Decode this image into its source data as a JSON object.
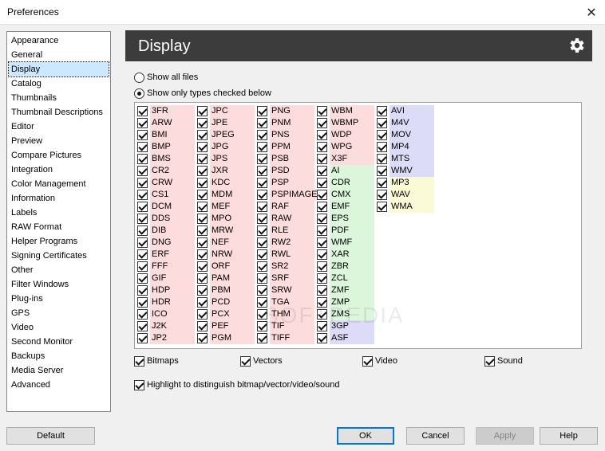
{
  "window": {
    "title": "Preferences",
    "close_glyph": "✕"
  },
  "sidebar": {
    "items": [
      {
        "label": "Appearance"
      },
      {
        "label": "General"
      },
      {
        "label": "Display",
        "selected": true
      },
      {
        "label": "Catalog"
      },
      {
        "label": "Thumbnails"
      },
      {
        "label": "Thumbnail Descriptions"
      },
      {
        "label": "Editor"
      },
      {
        "label": "Preview"
      },
      {
        "label": "Compare Pictures"
      },
      {
        "label": "Integration"
      },
      {
        "label": "Color Management"
      },
      {
        "label": "Information"
      },
      {
        "label": "Labels"
      },
      {
        "label": "RAW Format"
      },
      {
        "label": "Helper Programs"
      },
      {
        "label": "Signing Certificates"
      },
      {
        "label": "Other"
      },
      {
        "label": "Filter Windows"
      },
      {
        "label": "Plug-ins"
      },
      {
        "label": "GPS"
      },
      {
        "label": "Video"
      },
      {
        "label": "Second Monitor"
      },
      {
        "label": "Backups"
      },
      {
        "label": "Media Server"
      },
      {
        "label": "Advanced"
      }
    ]
  },
  "header": {
    "title": "Display",
    "icon": "gear-icon"
  },
  "filter_mode": {
    "show_all": {
      "label": "Show all files",
      "selected": false
    },
    "show_only": {
      "label": "Show only types checked below",
      "selected": true
    }
  },
  "colors": {
    "bitmap": "#fcdcdc",
    "vector": "#dcf6dc",
    "video": "#dcdcf8",
    "sound": "#fafad6",
    "header_bg": "#3c3c3c",
    "selection": "#cce8ff"
  },
  "file_types": {
    "columns": [
      [
        {
          "label": "3FR",
          "kind": "bitmap"
        },
        {
          "label": "ARW",
          "kind": "bitmap"
        },
        {
          "label": "BMI",
          "kind": "bitmap"
        },
        {
          "label": "BMP",
          "kind": "bitmap"
        },
        {
          "label": "BMS",
          "kind": "bitmap"
        },
        {
          "label": "CR2",
          "kind": "bitmap"
        },
        {
          "label": "CRW",
          "kind": "bitmap"
        },
        {
          "label": "CS1",
          "kind": "bitmap"
        },
        {
          "label": "DCM",
          "kind": "bitmap"
        },
        {
          "label": "DDS",
          "kind": "bitmap"
        },
        {
          "label": "DIB",
          "kind": "bitmap"
        },
        {
          "label": "DNG",
          "kind": "bitmap"
        },
        {
          "label": "ERF",
          "kind": "bitmap"
        },
        {
          "label": "FFF",
          "kind": "bitmap"
        },
        {
          "label": "GIF",
          "kind": "bitmap"
        },
        {
          "label": "HDP",
          "kind": "bitmap"
        },
        {
          "label": "HDR",
          "kind": "bitmap"
        },
        {
          "label": "ICO",
          "kind": "bitmap"
        },
        {
          "label": "J2K",
          "kind": "bitmap"
        },
        {
          "label": "JP2",
          "kind": "bitmap"
        }
      ],
      [
        {
          "label": "JPC",
          "kind": "bitmap"
        },
        {
          "label": "JPE",
          "kind": "bitmap"
        },
        {
          "label": "JPEG",
          "kind": "bitmap"
        },
        {
          "label": "JPG",
          "kind": "bitmap"
        },
        {
          "label": "JPS",
          "kind": "bitmap"
        },
        {
          "label": "JXR",
          "kind": "bitmap"
        },
        {
          "label": "KDC",
          "kind": "bitmap"
        },
        {
          "label": "MDM",
          "kind": "bitmap"
        },
        {
          "label": "MEF",
          "kind": "bitmap"
        },
        {
          "label": "MPO",
          "kind": "bitmap"
        },
        {
          "label": "MRW",
          "kind": "bitmap"
        },
        {
          "label": "NEF",
          "kind": "bitmap"
        },
        {
          "label": "NRW",
          "kind": "bitmap"
        },
        {
          "label": "ORF",
          "kind": "bitmap"
        },
        {
          "label": "PAM",
          "kind": "bitmap"
        },
        {
          "label": "PBM",
          "kind": "bitmap"
        },
        {
          "label": "PCD",
          "kind": "bitmap"
        },
        {
          "label": "PCX",
          "kind": "bitmap"
        },
        {
          "label": "PEF",
          "kind": "bitmap"
        },
        {
          "label": "PGM",
          "kind": "bitmap"
        }
      ],
      [
        {
          "label": "PNG",
          "kind": "bitmap"
        },
        {
          "label": "PNM",
          "kind": "bitmap"
        },
        {
          "label": "PNS",
          "kind": "bitmap"
        },
        {
          "label": "PPM",
          "kind": "bitmap"
        },
        {
          "label": "PSB",
          "kind": "bitmap"
        },
        {
          "label": "PSD",
          "kind": "bitmap"
        },
        {
          "label": "PSP",
          "kind": "bitmap"
        },
        {
          "label": "PSPIMAGE",
          "kind": "bitmap"
        },
        {
          "label": "RAF",
          "kind": "bitmap"
        },
        {
          "label": "RAW",
          "kind": "bitmap"
        },
        {
          "label": "RLE",
          "kind": "bitmap"
        },
        {
          "label": "RW2",
          "kind": "bitmap"
        },
        {
          "label": "RWL",
          "kind": "bitmap"
        },
        {
          "label": "SR2",
          "kind": "bitmap"
        },
        {
          "label": "SRF",
          "kind": "bitmap"
        },
        {
          "label": "SRW",
          "kind": "bitmap"
        },
        {
          "label": "TGA",
          "kind": "bitmap"
        },
        {
          "label": "THM",
          "kind": "bitmap"
        },
        {
          "label": "TIF",
          "kind": "bitmap"
        },
        {
          "label": "TIFF",
          "kind": "bitmap"
        }
      ],
      [
        {
          "label": "WBM",
          "kind": "bitmap"
        },
        {
          "label": "WBMP",
          "kind": "bitmap"
        },
        {
          "label": "WDP",
          "kind": "bitmap"
        },
        {
          "label": "WPG",
          "kind": "bitmap"
        },
        {
          "label": "X3F",
          "kind": "bitmap"
        },
        {
          "label": "AI",
          "kind": "vector"
        },
        {
          "label": "CDR",
          "kind": "vector"
        },
        {
          "label": "CMX",
          "kind": "vector"
        },
        {
          "label": "EMF",
          "kind": "vector"
        },
        {
          "label": "EPS",
          "kind": "vector"
        },
        {
          "label": "PDF",
          "kind": "vector"
        },
        {
          "label": "WMF",
          "kind": "vector"
        },
        {
          "label": "XAR",
          "kind": "vector"
        },
        {
          "label": "ZBR",
          "kind": "vector"
        },
        {
          "label": "ZCL",
          "kind": "vector"
        },
        {
          "label": "ZMF",
          "kind": "vector"
        },
        {
          "label": "ZMP",
          "kind": "vector"
        },
        {
          "label": "ZMS",
          "kind": "vector"
        },
        {
          "label": "3GP",
          "kind": "video"
        },
        {
          "label": "ASF",
          "kind": "video"
        }
      ],
      [
        {
          "label": "AVI",
          "kind": "video"
        },
        {
          "label": "M4V",
          "kind": "video"
        },
        {
          "label": "MOV",
          "kind": "video"
        },
        {
          "label": "MP4",
          "kind": "video"
        },
        {
          "label": "MTS",
          "kind": "video"
        },
        {
          "label": "WMV",
          "kind": "video"
        },
        {
          "label": "MP3",
          "kind": "sound"
        },
        {
          "label": "WAV",
          "kind": "sound"
        },
        {
          "label": "WMA",
          "kind": "sound"
        }
      ]
    ]
  },
  "categories": [
    {
      "label": "Bitmaps",
      "checked": true
    },
    {
      "label": "Vectors",
      "checked": true
    },
    {
      "label": "Video",
      "checked": true
    },
    {
      "label": "Sound",
      "checked": true
    }
  ],
  "highlight": {
    "label": "Highlight to distinguish bitmap/vector/video/sound",
    "checked": true
  },
  "buttons": {
    "default": "Default",
    "ok": "OK",
    "cancel": "Cancel",
    "apply": "Apply",
    "help": "Help"
  }
}
